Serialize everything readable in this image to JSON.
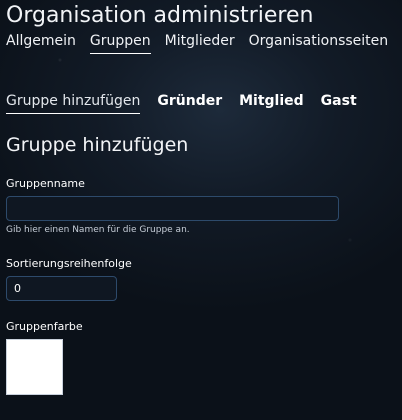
{
  "page": {
    "title": "Organisation administrieren"
  },
  "main_tabs": [
    {
      "label": "Allgemein",
      "active": false
    },
    {
      "label": "Gruppen",
      "active": true
    },
    {
      "label": "Mitglieder",
      "active": false
    },
    {
      "label": "Organisationsseiten",
      "active": false
    }
  ],
  "sub_tabs": [
    {
      "label": "Gruppe hinzufügen",
      "active": true
    },
    {
      "label": "Gründer",
      "active": false
    },
    {
      "label": "Mitglied",
      "active": false
    },
    {
      "label": "Gast",
      "active": false
    }
  ],
  "form": {
    "section_title": "Gruppe hinzufügen",
    "group_name": {
      "label": "Gruppenname",
      "value": "",
      "help": "Gib hier einen Namen für die Gruppe an."
    },
    "sort_order": {
      "label": "Sortierungsreihenfolge",
      "value": "0"
    },
    "group_color": {
      "label": "Gruppenfarbe",
      "value": "#ffffff"
    }
  },
  "colors": {
    "input_border": "#2d4a6b",
    "input_background": "#0f1722",
    "text": "#ffffff"
  }
}
